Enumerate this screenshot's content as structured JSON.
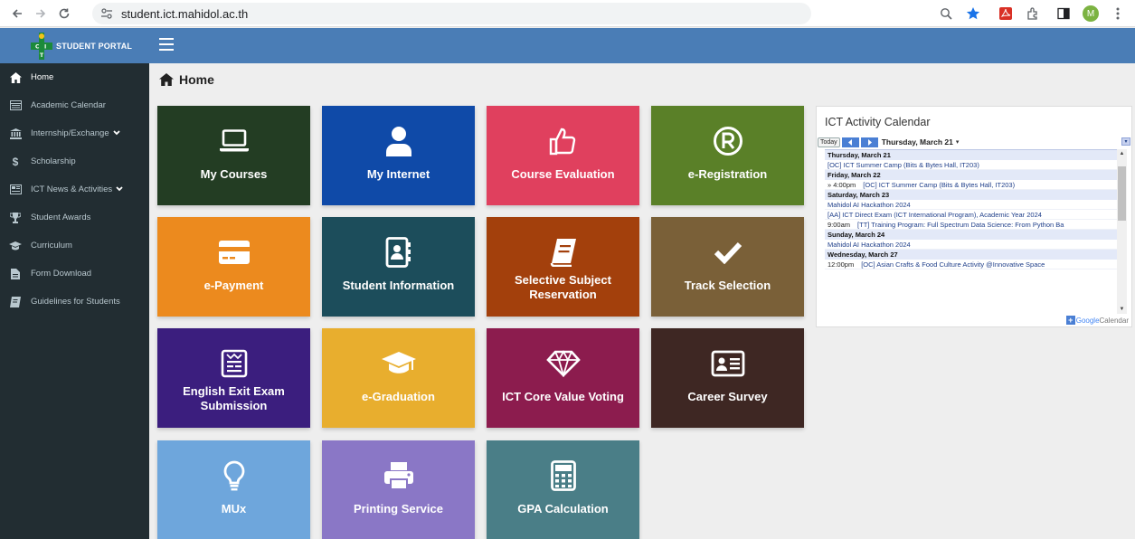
{
  "browser": {
    "url": "student.ict.mahidol.ac.th",
    "avatar_letter": "M"
  },
  "header": {
    "brand_text": "STUDENT PORTAL",
    "colors": {
      "header_bg": "#4a7db6",
      "sidebar_bg": "#222d32"
    }
  },
  "sidebar": {
    "items": [
      {
        "label": "Home",
        "icon": "home-icon"
      },
      {
        "label": "Academic Calendar",
        "icon": "calendar-icon"
      },
      {
        "label": "Internship/Exchange",
        "icon": "bank-icon"
      },
      {
        "label": "Scholarship",
        "icon": "dollar-icon"
      },
      {
        "label": "ICT News & Activities",
        "icon": "newspaper-icon"
      },
      {
        "label": "Student Awards",
        "icon": "trophy-icon"
      },
      {
        "label": "Curriculum",
        "icon": "graduation-cap-icon"
      },
      {
        "label": "Form Download",
        "icon": "file-icon"
      },
      {
        "label": "Guidelines for Students",
        "icon": "book-icon"
      }
    ]
  },
  "main": {
    "title": "Home",
    "tiles": [
      {
        "label": "My Courses",
        "icon": "laptop-icon",
        "color": "#233d23"
      },
      {
        "label": "My Internet",
        "icon": "user-icon",
        "color": "#0f4aa8"
      },
      {
        "label": "Course Evaluation",
        "icon": "thumbs-up-icon",
        "color": "#e0405e"
      },
      {
        "label": "e-Registration",
        "icon": "registered-icon",
        "color": "#5a8028"
      },
      {
        "label": "e-Payment",
        "icon": "credit-card-icon",
        "color": "#ec8a1e"
      },
      {
        "label": "Student Information",
        "icon": "address-book-icon",
        "color": "#1c4d5b"
      },
      {
        "label": "Selective Subject Reservation",
        "icon": "book-icon",
        "color": "#a3400c"
      },
      {
        "label": "Track Selection",
        "icon": "check-icon",
        "color": "#7a6038"
      },
      {
        "label": "English Exit Exam Submission",
        "icon": "newspaper-icon",
        "color": "#3b1e7e"
      },
      {
        "label": "e-Graduation",
        "icon": "graduation-cap-icon",
        "color": "#e8ae2e"
      },
      {
        "label": "ICT Core Value Voting",
        "icon": "diamond-icon",
        "color": "#8c1c4e"
      },
      {
        "label": "Career Survey",
        "icon": "id-card-icon",
        "color": "#3e2723"
      },
      {
        "label": "MUx",
        "icon": "lightbulb-icon",
        "color": "#6ea6dc"
      },
      {
        "label": "Printing Service",
        "icon": "printer-icon",
        "color": "#8a77c6"
      },
      {
        "label": "GPA Calculation",
        "icon": "calculator-icon",
        "color": "#4a7e87"
      }
    ]
  },
  "calendar": {
    "title": "ICT Activity Calendar",
    "today_label": "Today",
    "current_date": "Thursday, March 21",
    "powered_by_google": "Google",
    "powered_by_calendar": "Calendar",
    "rows": [
      {
        "kind": "day",
        "text": "Thursday, March 21"
      },
      {
        "kind": "event",
        "time": "",
        "text": "[OC] ICT Summer Camp (Bits & Bytes Hall, IT203)"
      },
      {
        "kind": "day",
        "text": "Friday, March 22"
      },
      {
        "kind": "event",
        "time": "» 4:00pm",
        "text": "[OC] ICT Summer Camp (Bits & Bytes Hall, IT203)"
      },
      {
        "kind": "day",
        "text": "Saturday, March 23"
      },
      {
        "kind": "event",
        "time": "",
        "text": "Mahidol AI Hackathon 2024"
      },
      {
        "kind": "event",
        "time": "",
        "text": "[AA] ICT Direct Exam (ICT International Program), Academic Year 2024"
      },
      {
        "kind": "event",
        "time": "9:00am",
        "text": "[TT] Training Program: Full Spectrum Data Science: From Python Ba"
      },
      {
        "kind": "day",
        "text": "Sunday, March 24"
      },
      {
        "kind": "event",
        "time": "",
        "text": "Mahidol AI Hackathon 2024"
      },
      {
        "kind": "day",
        "text": "Wednesday, March 27"
      },
      {
        "kind": "event",
        "time": "12:00pm",
        "text": "[OC] Asian Crafts & Food Culture Activity @Innovative Space"
      }
    ]
  }
}
